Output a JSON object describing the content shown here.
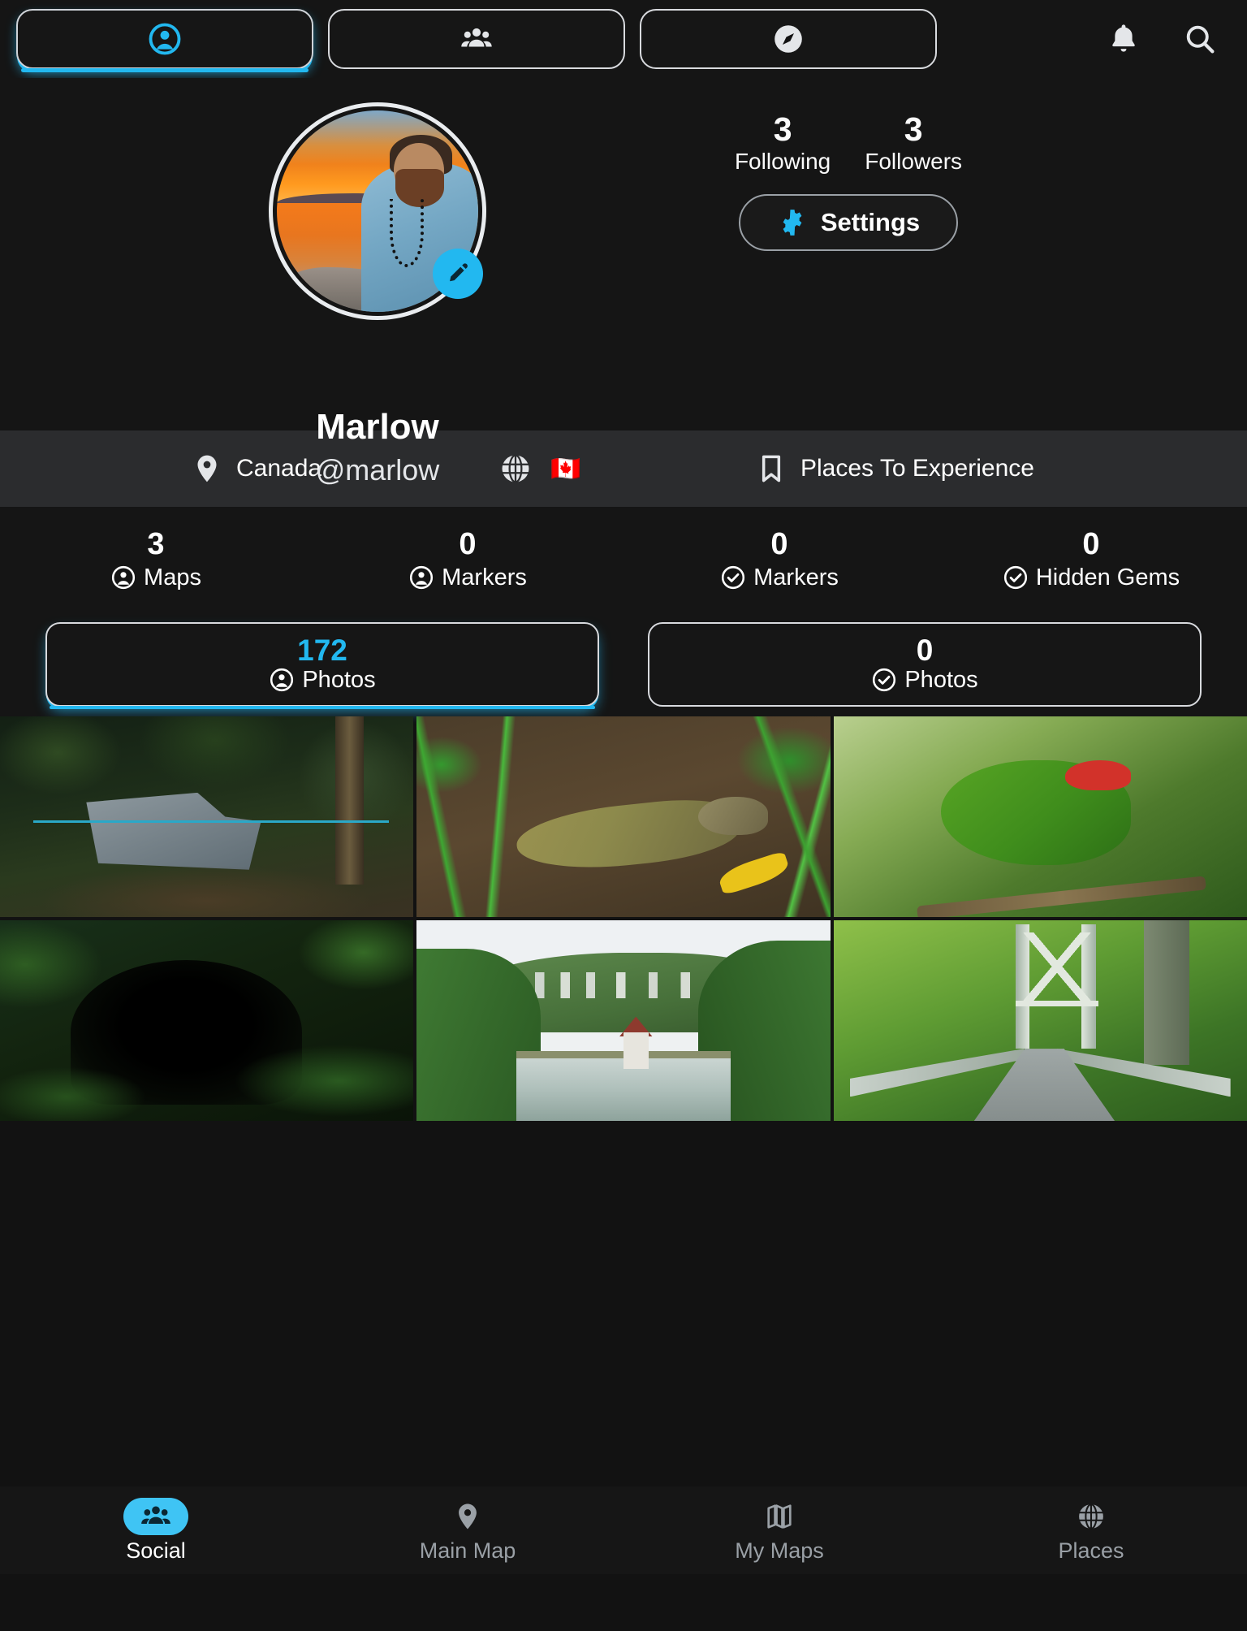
{
  "topbar": {
    "tabs": [
      {
        "name": "profile-tab",
        "icon": "person-circle-icon",
        "active": true
      },
      {
        "name": "friends-tab",
        "icon": "people-group-icon",
        "active": false
      },
      {
        "name": "explore-tab",
        "icon": "compass-icon",
        "active": false
      }
    ],
    "notifications_icon": "bell-icon",
    "search_icon": "search-icon"
  },
  "profile": {
    "avatar_alt": "sunset-beach-portrait",
    "edit_icon": "pencil-icon",
    "display_name": "Marlow",
    "handle": "@marlow",
    "following": {
      "count": "3",
      "label": "Following"
    },
    "followers": {
      "count": "3",
      "label": "Followers"
    },
    "settings": {
      "label": "Settings",
      "icon": "gear-icon"
    }
  },
  "infobar": {
    "location": {
      "icon": "map-pin-icon",
      "text": "Canada"
    },
    "globe": {
      "icon": "globe-icon",
      "flag": "🇨🇦"
    },
    "bookmark": {
      "icon": "bookmark-icon",
      "text": "Places To Experience"
    }
  },
  "counters": [
    {
      "count": "3",
      "label": "Maps",
      "icon": "person-circle-icon"
    },
    {
      "count": "0",
      "label": "Markers",
      "icon": "person-circle-icon"
    },
    {
      "count": "0",
      "label": "Markers",
      "icon": "check-circle-icon"
    },
    {
      "count": "0",
      "label": "Hidden Gems",
      "icon": "check-circle-icon"
    }
  ],
  "photo_tabs": [
    {
      "count": "172",
      "label": "Photos",
      "icon": "person-circle-icon",
      "active": true
    },
    {
      "count": "0",
      "label": "Photos",
      "icon": "check-circle-icon",
      "active": false
    }
  ],
  "photo_grid": [
    {
      "name": "photo-mine-cart-forest"
    },
    {
      "name": "photo-tuatara-reptile"
    },
    {
      "name": "photo-green-parakeet"
    },
    {
      "name": "photo-dark-tunnel"
    },
    {
      "name": "photo-reservoir-valley"
    },
    {
      "name": "photo-swing-bridge"
    }
  ],
  "bottom_nav": [
    {
      "label": "Social",
      "icon": "people-group-icon",
      "active": true
    },
    {
      "label": "Main Map",
      "icon": "map-pin-icon",
      "active": false
    },
    {
      "label": "My Maps",
      "icon": "folded-map-icon",
      "active": false
    },
    {
      "label": "Places",
      "icon": "globe-icon",
      "active": false
    }
  ],
  "colors": {
    "accent": "#22b8f0",
    "nav_accent": "#3fc4f4",
    "background": "#121212",
    "panel": "#151515",
    "infobar": "#2b2c2e",
    "text": "#ffffff",
    "muted": "#9aa0a6"
  }
}
